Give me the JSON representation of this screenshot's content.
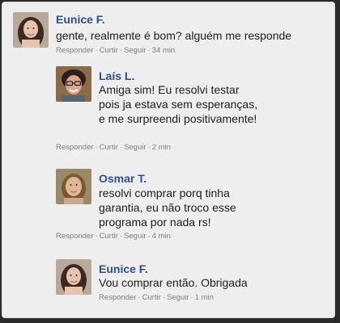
{
  "comments": [
    {
      "name": "Eunice F.",
      "text": "gente, realmente é bom? alguém me responde",
      "actions": {
        "reply": "Responder",
        "like": "Curtir",
        "follow": "Seguir",
        "time": "34 min"
      }
    },
    {
      "name": "Laís L.",
      "text": "Amiga sim! Eu resolvi testar pois ja estava sem esperanças, e me surpreendi positivamente!",
      "actions": {
        "reply": "Responder",
        "like": "Curtir",
        "follow": "Seguir",
        "time": "2 min"
      }
    },
    {
      "name": "Osmar T.",
      "text": "resolvi comprar porq tinha garantia, eu não troco esse programa por nada rs!",
      "actions": {
        "reply": "Responder",
        "like": "Curtir",
        "follow": "Seguir",
        "time": "4 min"
      }
    },
    {
      "name": "Eunice F.",
      "text": "Vou comprar então. Obrigada",
      "actions": {
        "reply": "Responder",
        "like": "Curtir",
        "follow": "Seguir",
        "time": "1 min"
      }
    }
  ],
  "separator": "·"
}
